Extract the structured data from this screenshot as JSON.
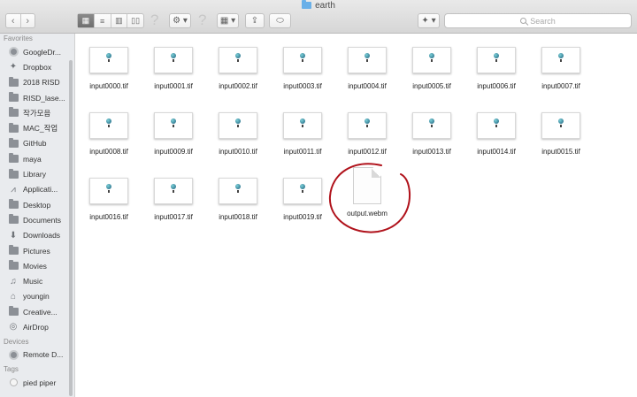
{
  "window": {
    "title": "earth"
  },
  "toolbar": {
    "back_icon": "‹",
    "forward_icon": "›",
    "views": [
      "▦",
      "≡",
      "▥",
      "▯▯"
    ],
    "help_glyph": "?",
    "action_label": "⚙ ▾",
    "arrange_label": "▦ ▾",
    "share_label": "⇪",
    "tag_label": "⬭",
    "dropbox_label": "✦ ▾"
  },
  "search": {
    "placeholder": "Search"
  },
  "sidebar": {
    "favorites_header": "Favorites",
    "favorites": [
      {
        "label": "GoogleDr...",
        "icon": "disk"
      },
      {
        "label": "Dropbox",
        "icon": "dropbox"
      },
      {
        "label": "2018 RISD",
        "icon": "folder"
      },
      {
        "label": "RISD_lase...",
        "icon": "folder"
      },
      {
        "label": "작가모음",
        "icon": "folder"
      },
      {
        "label": "MAC_작업",
        "icon": "folder"
      },
      {
        "label": "GitHub",
        "icon": "folder"
      },
      {
        "label": "maya",
        "icon": "folder"
      },
      {
        "label": "Library",
        "icon": "folder"
      },
      {
        "label": "Applicati...",
        "icon": "apps"
      },
      {
        "label": "Desktop",
        "icon": "folder"
      },
      {
        "label": "Documents",
        "icon": "folder"
      },
      {
        "label": "Downloads",
        "icon": "downloads"
      },
      {
        "label": "Pictures",
        "icon": "folder"
      },
      {
        "label": "Movies",
        "icon": "folder"
      },
      {
        "label": "Music",
        "icon": "music"
      },
      {
        "label": "youngin",
        "icon": "home"
      },
      {
        "label": "Creative...",
        "icon": "folder"
      },
      {
        "label": "AirDrop",
        "icon": "airdrop"
      }
    ],
    "devices_header": "Devices",
    "devices": [
      {
        "label": "Remote D...",
        "icon": "disk"
      }
    ],
    "tags_header": "Tags",
    "tags": [
      {
        "label": "pied piper",
        "icon": "tag"
      }
    ]
  },
  "files": [
    "input0000.tif",
    "input0001.tif",
    "input0002.tif",
    "input0003.tif",
    "input0004.tif",
    "input0005.tif",
    "input0006.tif",
    "input0007.tif",
    "input0008.tif",
    "input0009.tif",
    "input0010.tif",
    "input0011.tif",
    "input0012.tif",
    "input0013.tif",
    "input0014.tif",
    "input0015.tif",
    "input0016.tif",
    "input0017.tif",
    "input0018.tif",
    "input0019.tif",
    "output.webm"
  ],
  "annotation": {
    "color": "#b0121b"
  }
}
